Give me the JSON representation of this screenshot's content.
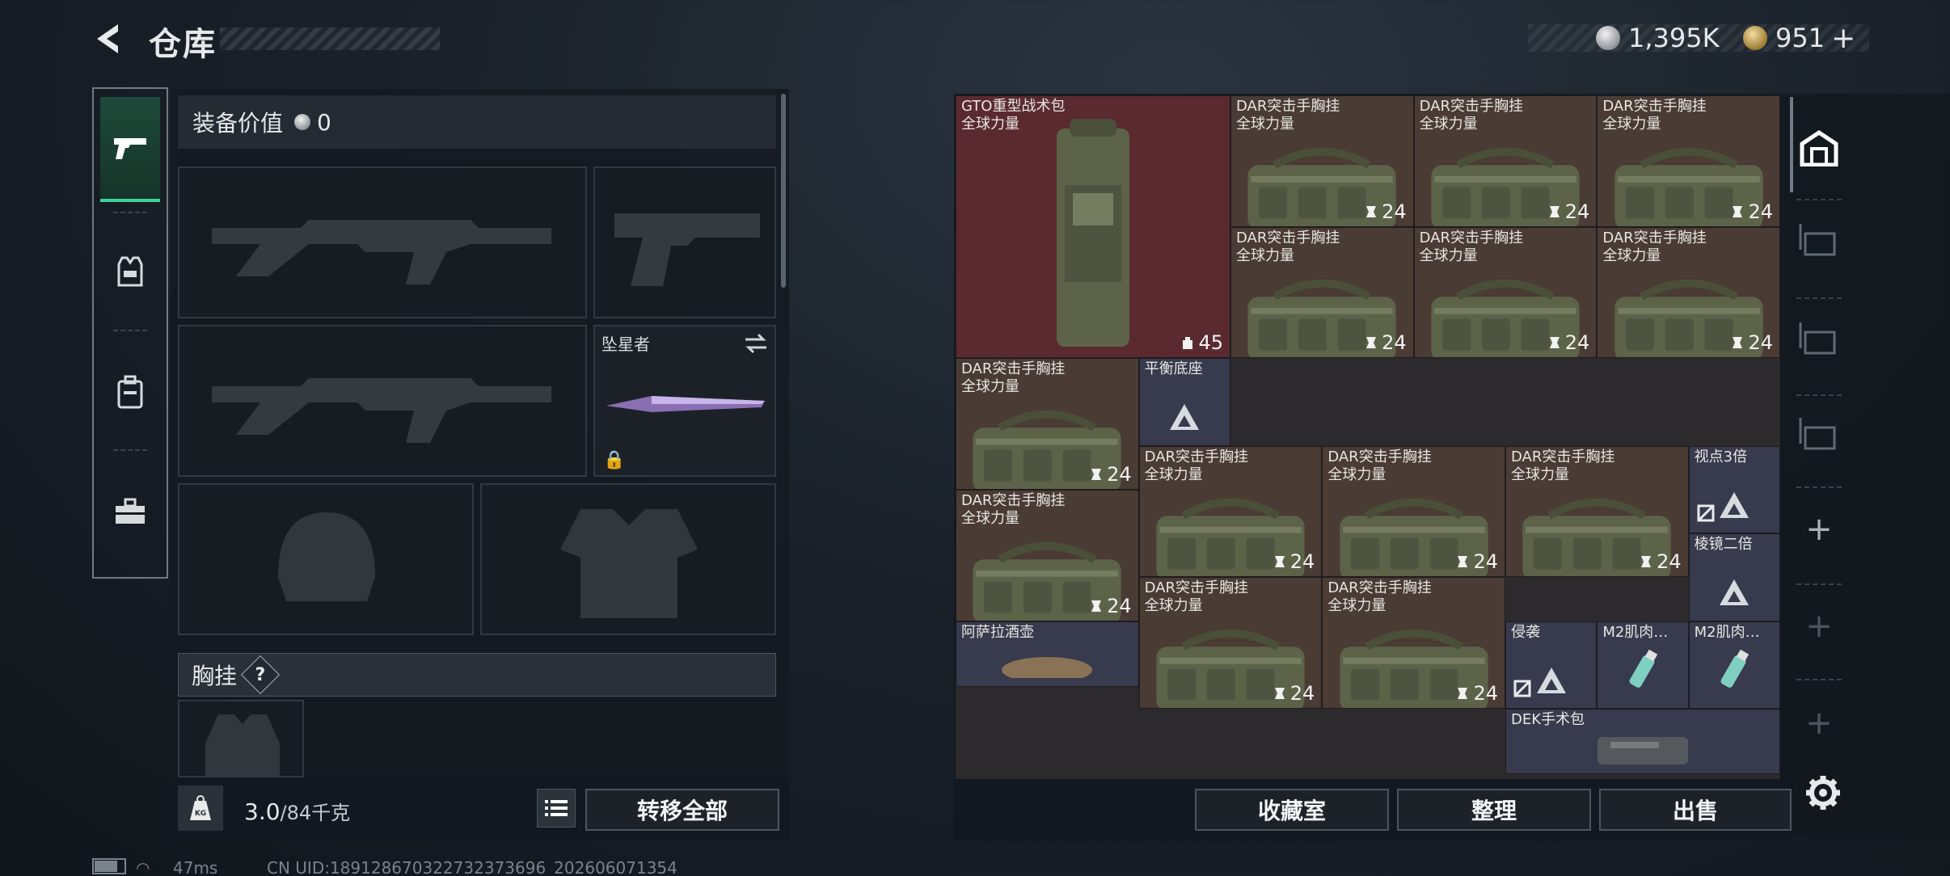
{
  "header": {
    "title": "仓库",
    "currency_silver": "1,395K",
    "currency_gold": "951",
    "gold_add": "+"
  },
  "rail_tabs": [
    {
      "name": "weapons-tab",
      "icon": "pistol-icon"
    },
    {
      "name": "armor-tab",
      "icon": "vest-icon"
    },
    {
      "name": "backpack-tab",
      "icon": "backpack-icon"
    },
    {
      "name": "toolbox-tab",
      "icon": "toolbox-icon"
    }
  ],
  "equipment": {
    "value_label": "装备价值",
    "value": "0",
    "melee_name": "坠星者",
    "chest_rig_label": "胸挂",
    "help": "?"
  },
  "capacity": {
    "current": "3.0",
    "max": "/84千克",
    "kg_badge": "KG"
  },
  "buttons": {
    "transfer_all": "转移全部",
    "collection": "收藏室",
    "organize": "整理",
    "sell": "出售"
  },
  "stash": {
    "items": [
      {
        "name": "GTO重型战术包",
        "sub": "全球力量",
        "count": "45"
      },
      {
        "name": "DAR突击手胸挂",
        "sub": "全球力量",
        "count": "24"
      },
      {
        "name": "平衡底座",
        "sub": ""
      },
      {
        "name": "视点3倍",
        "sub": ""
      },
      {
        "name": "棱镜二倍",
        "sub": ""
      },
      {
        "name": "侵袭",
        "sub": ""
      },
      {
        "name": "M2肌肉…",
        "sub": ""
      },
      {
        "name": "阿萨拉酒壶",
        "sub": ""
      },
      {
        "name": "DEK手术包",
        "sub": ""
      }
    ]
  },
  "status": {
    "ping": "47ms",
    "uid": "CN UID:18912867032273237369​6_202606071354"
  },
  "colors": {
    "accent": "#3fd39a",
    "cell_brown": "#4a3b34",
    "cell_red": "#5a2a30",
    "cell_blue": "#383a4e"
  }
}
